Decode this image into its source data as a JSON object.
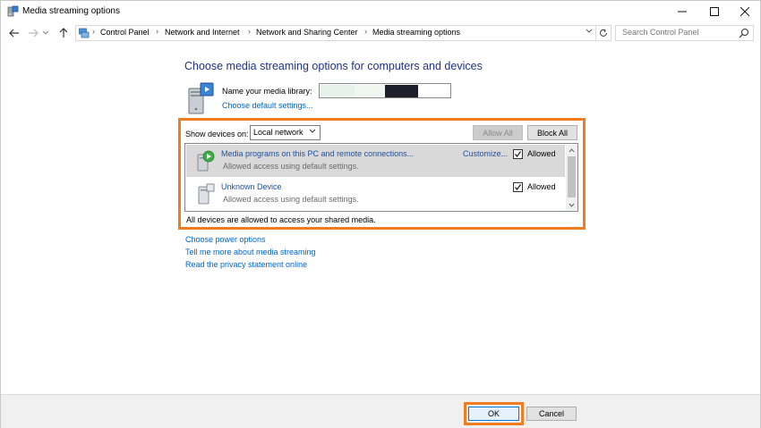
{
  "window": {
    "title": "Media streaming options"
  },
  "address": {
    "breadcrumbs": [
      "Control Panel",
      "Network and Internet",
      "Network and Sharing Center",
      "Media streaming options"
    ],
    "search_placeholder": "Search Control Panel"
  },
  "content": {
    "heading": "Choose media streaming options for computers and devices",
    "library_label": "Name your media library:",
    "choose_default_link": "Choose default settings...",
    "show_devices_label": "Show devices on:",
    "show_devices_value": "Local network",
    "allow_all_label": "Allow All",
    "block_all_label": "Block All",
    "devices": [
      {
        "name": "Media programs on this PC and remote connections...",
        "status": "Allowed access using default settings.",
        "customize_label": "Customize...",
        "allowed_label": "Allowed",
        "checked": true,
        "selected": true
      },
      {
        "name": "Unknown Device",
        "status": "Allowed access using default settings.",
        "allowed_label": "Allowed",
        "checked": true,
        "selected": false
      }
    ],
    "status_text": "All devices are allowed to access your shared media.",
    "links": {
      "power": "Choose power options",
      "more": "Tell me more about media streaming",
      "privacy": "Read the privacy statement online"
    }
  },
  "footer": {
    "ok_label": "OK",
    "cancel_label": "Cancel"
  },
  "colors": {
    "highlight": "#f07d22",
    "link": "#0066cc",
    "heading": "#1e3287",
    "selected_row": "#d9d9d9"
  }
}
